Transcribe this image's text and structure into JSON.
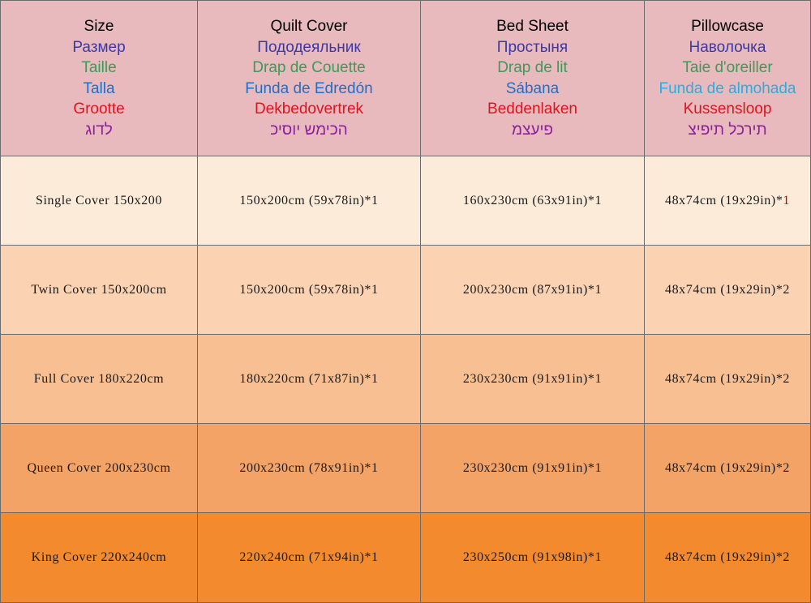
{
  "headers": [
    {
      "lines": [
        "Size",
        "Размер",
        "Taille",
        "Talla",
        "Grootte",
        "לדוג"
      ]
    },
    {
      "lines": [
        "Quilt Cover",
        "Пододеяльник",
        "Drap de Couette",
        "Funda de Edredón",
        "Dekbedovertrek",
        "הכימש יוסיכ"
      ]
    },
    {
      "lines": [
        "Bed Sheet",
        "Простыня",
        "Drap de lit",
        "Sábana",
        "Beddenlaken",
        "פיעצמ"
      ]
    },
    {
      "lines": [
        "Pillowcase",
        "Наволочка",
        "Taie d'oreiller",
        "Funda de almohada",
        "Kussensloop",
        "תירכל תיפיצ"
      ]
    }
  ],
  "rows": [
    {
      "size": "Single Cover 150x200",
      "quilt": "150x200cm (59x78in)*1",
      "sheet": "160x230cm (63x91in)*1",
      "pillow": "48x74cm (19x29in)*",
      "pillow_qty": "1"
    },
    {
      "size": "Twin Cover 150x200cm",
      "quilt": "150x200cm (59x78in)*1",
      "sheet": "200x230cm (87x91in)*1",
      "pillow": "48x74cm (19x29in)*2"
    },
    {
      "size": "Full Cover 180x220cm",
      "quilt": "180x220cm (71x87in)*1",
      "sheet": "230x230cm (91x91in)*1",
      "pillow": "48x74cm (19x29in)*2"
    },
    {
      "size": "Queen Cover 200x230cm",
      "quilt": "200x230cm (78x91in)*1",
      "sheet": "230x230cm (91x91in)*1",
      "pillow": "48x74cm (19x29in)*2"
    },
    {
      "size": "King Cover 220x240cm",
      "quilt": "220x240cm (71x94in)*1",
      "sheet": "230x250cm (91x98in)*1",
      "pillow": "48x74cm (19x29in)*2"
    }
  ],
  "colors": {
    "header_bg": "#e8b9bd",
    "row_bgs": [
      "#fdebd9",
      "#fbd3b3",
      "#f8c092",
      "#f4a367",
      "#f48a2e"
    ],
    "russian_text": "#3a3aa6",
    "french_text": "#3c9a5a",
    "spanish_text": "#1f70c8",
    "dutch_text": "#e0141e",
    "hebrew_text": "#8a1fa0"
  }
}
